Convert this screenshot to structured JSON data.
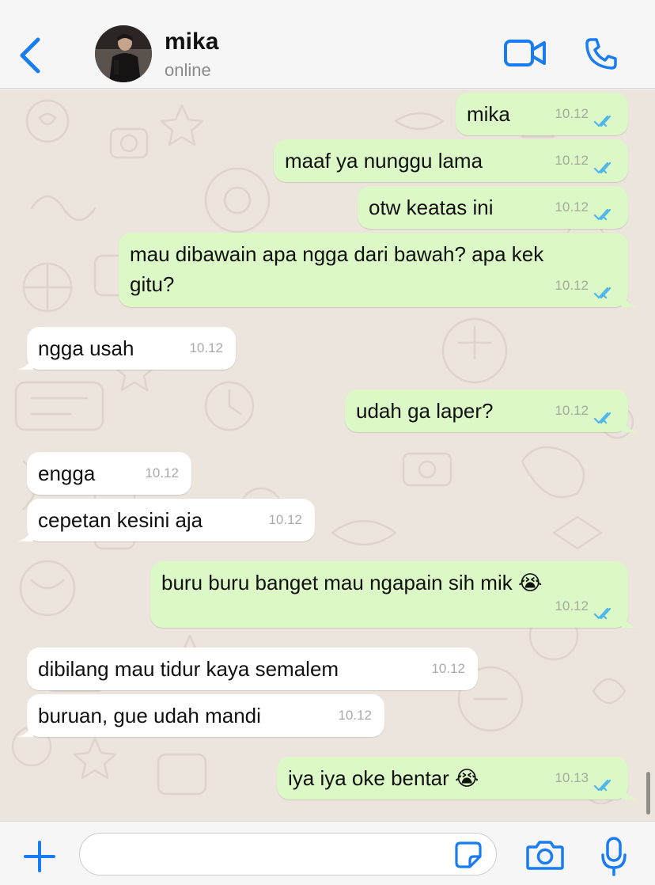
{
  "header": {
    "contact_name": "mika",
    "contact_status": "online",
    "accent_color": "#1a7cf4"
  },
  "messages": [
    {
      "direction": "outgoing",
      "text": "mika",
      "time": "10.12",
      "status": "read"
    },
    {
      "direction": "outgoing",
      "text": "maaf ya nunggu lama",
      "time": "10.12",
      "status": "read"
    },
    {
      "direction": "outgoing",
      "text": "otw keatas ini",
      "time": "10.12",
      "status": "read"
    },
    {
      "direction": "outgoing",
      "text": "mau dibawain apa ngga dari bawah? apa kek\ngitu?",
      "time": "10.12",
      "status": "read"
    },
    {
      "direction": "incoming",
      "text": "ngga usah",
      "time": "10.12"
    },
    {
      "direction": "outgoing",
      "text": "udah ga laper?",
      "time": "10.12",
      "status": "read"
    },
    {
      "direction": "incoming",
      "text": "engga",
      "time": "10.12"
    },
    {
      "direction": "incoming",
      "text": "cepetan kesini aja",
      "time": "10.12"
    },
    {
      "direction": "outgoing",
      "text": "buru buru banget mau ngapain sih mik 😭",
      "time": "10.12",
      "status": "read"
    },
    {
      "direction": "incoming",
      "text": "dibilang mau tidur kaya semalem",
      "time": "10.12"
    },
    {
      "direction": "incoming",
      "text": "buruan, gue udah mandi",
      "time": "10.12"
    },
    {
      "direction": "outgoing",
      "text": "iya iya oke bentar 😭",
      "time": "10.13",
      "status": "read"
    }
  ],
  "composer": {
    "value": "",
    "placeholder": ""
  },
  "icons": {
    "back": "chevron-left-icon",
    "video": "video-camera-icon",
    "call": "phone-icon",
    "attach": "plus-icon",
    "sticker": "sticker-icon",
    "camera": "camera-icon",
    "mic": "microphone-icon"
  },
  "colors": {
    "outgoing_bubble": "#dcf8c6",
    "incoming_bubble": "#ffffff",
    "wallpaper": "#ece5dd",
    "read_ticks": "#4fb6ec"
  }
}
